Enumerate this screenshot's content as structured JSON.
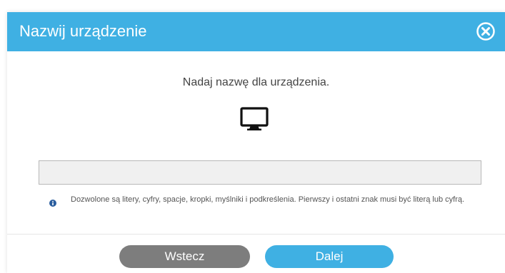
{
  "dialog": {
    "title": "Nazwij urządzenie",
    "prompt": "Nadaj nazwę dla urządzenia.",
    "device_icon": "monitor-icon",
    "input": {
      "value": "",
      "placeholder": ""
    },
    "hint": "Dozwolone są litery, cyfry, spacje, kropki, myślniki i podkreślenia. Pierwszy i ostatni znak musi być literą lub cyfrą.",
    "hint_icon": "info-icon",
    "close_icon": "close-icon",
    "buttons": {
      "back": "Wstecz",
      "next": "Dalej"
    }
  },
  "colors": {
    "accent": "#3fb0e3",
    "back_button": "#7d7d7d",
    "input_background": "#f0f0f0",
    "info_icon": "#2a5d9e"
  }
}
